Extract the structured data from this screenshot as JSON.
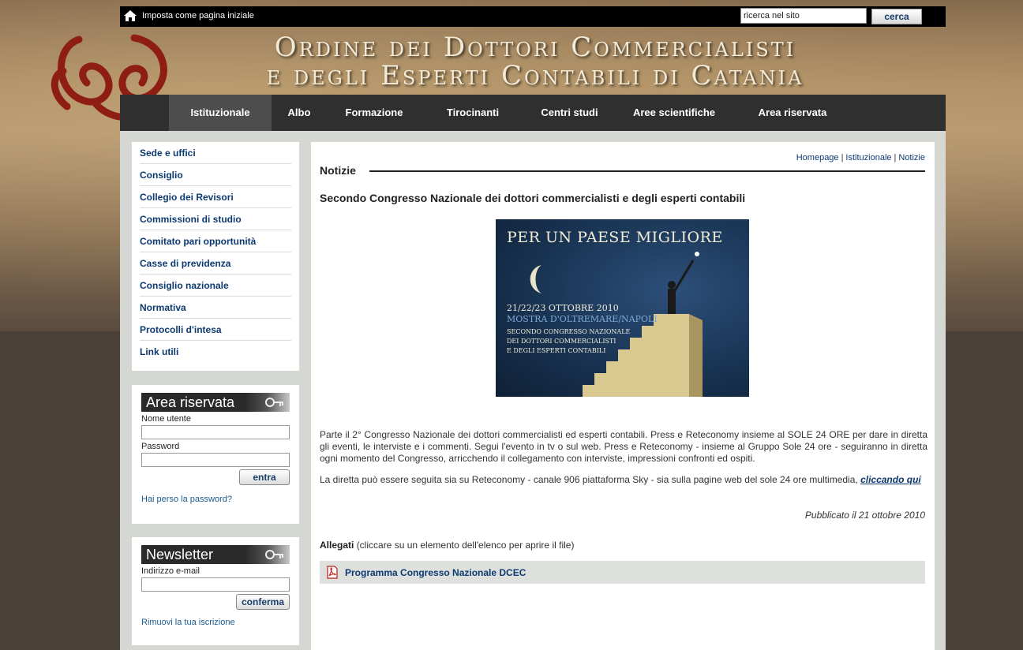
{
  "topbar": {
    "home_text": "Imposta come pagina iniziale",
    "search_value": "ricerca nel sito",
    "search_button": "cerca"
  },
  "header": {
    "title_line1": "Ordine dei Dottori Commercialisti",
    "title_line2": "e degli Esperti Contabili di Catania"
  },
  "nav": {
    "items": [
      {
        "label": "Istituzionale",
        "active": true
      },
      {
        "label": "Albo"
      },
      {
        "label": "Formazione"
      },
      {
        "label": "Tirocinanti"
      },
      {
        "label": "Centri studi"
      },
      {
        "label": "Aree scientifiche"
      },
      {
        "label": "Area riservata"
      }
    ]
  },
  "sidebar": {
    "menu": [
      "Sede e uffici",
      "Consiglio",
      "Collegio dei Revisori",
      "Commissioni di studio",
      "Comitato pari opportunità",
      "Casse di previdenza",
      "Consiglio nazionale",
      "Normativa",
      "Protocolli d'intesa",
      "Link utili"
    ],
    "login": {
      "title": "Area riservata",
      "username_label": "Nome utente",
      "password_label": "Password",
      "button": "entra",
      "forgot": "Hai perso la password?"
    },
    "newsletter": {
      "title": "Newsletter",
      "email_label": "Indirizzo e-mail",
      "button": "conferma",
      "unsubscribe": "Rimuovi la tua iscrizione"
    }
  },
  "main": {
    "breadcrumb": [
      "Homepage",
      "Istituzionale",
      "Notizie"
    ],
    "section_title": "Notizie",
    "article_title": "Secondo Congresso Nazionale dei dottori commercialisti e degli esperti contabili",
    "poster": {
      "headline": "PER UN PAESE MIGLIORE",
      "dates": "21/22/23 OTTOBRE 2010",
      "place": "MOSTRA D'OLTREMARE/NAPOLI",
      "sub1": "SECONDO CONGRESSO NAZIONALE",
      "sub2": "DEI DOTTORI COMMERCIALISTI",
      "sub3": "E DEGLI ESPERTI CONTABILI"
    },
    "paragraph1": "Parte il 2° Congresso Nazionale dei dottori commercialisti ed esperti contabili. Press e Reteconomy insieme al SOLE 24 ORE per dare in diretta gli eventi, le interviste e i commenti. Segui l'evento in tv o sul web. Press e Reteconomy - insieme al Gruppo Sole 24 ore - seguiranno in diretta ogni momento del Congresso, arricchendo il collegamento con interviste, impressioni confronti ed ospiti.",
    "paragraph2": "La diretta può essere seguita sia su Reteconomy - canale 906 piattaforma Sky - sia sulla pagine web del sole 24 ore multimedia,",
    "paragraph2_link": "cliccando qui",
    "published": "Pubblicato il 21 ottobre 2010",
    "attachments_heading": "Allegati",
    "attachments_note": "(cliccare su un elemento dell'elenco per aprire il file)",
    "attachments": [
      "Programma Congresso Nazionale DCEC"
    ]
  }
}
